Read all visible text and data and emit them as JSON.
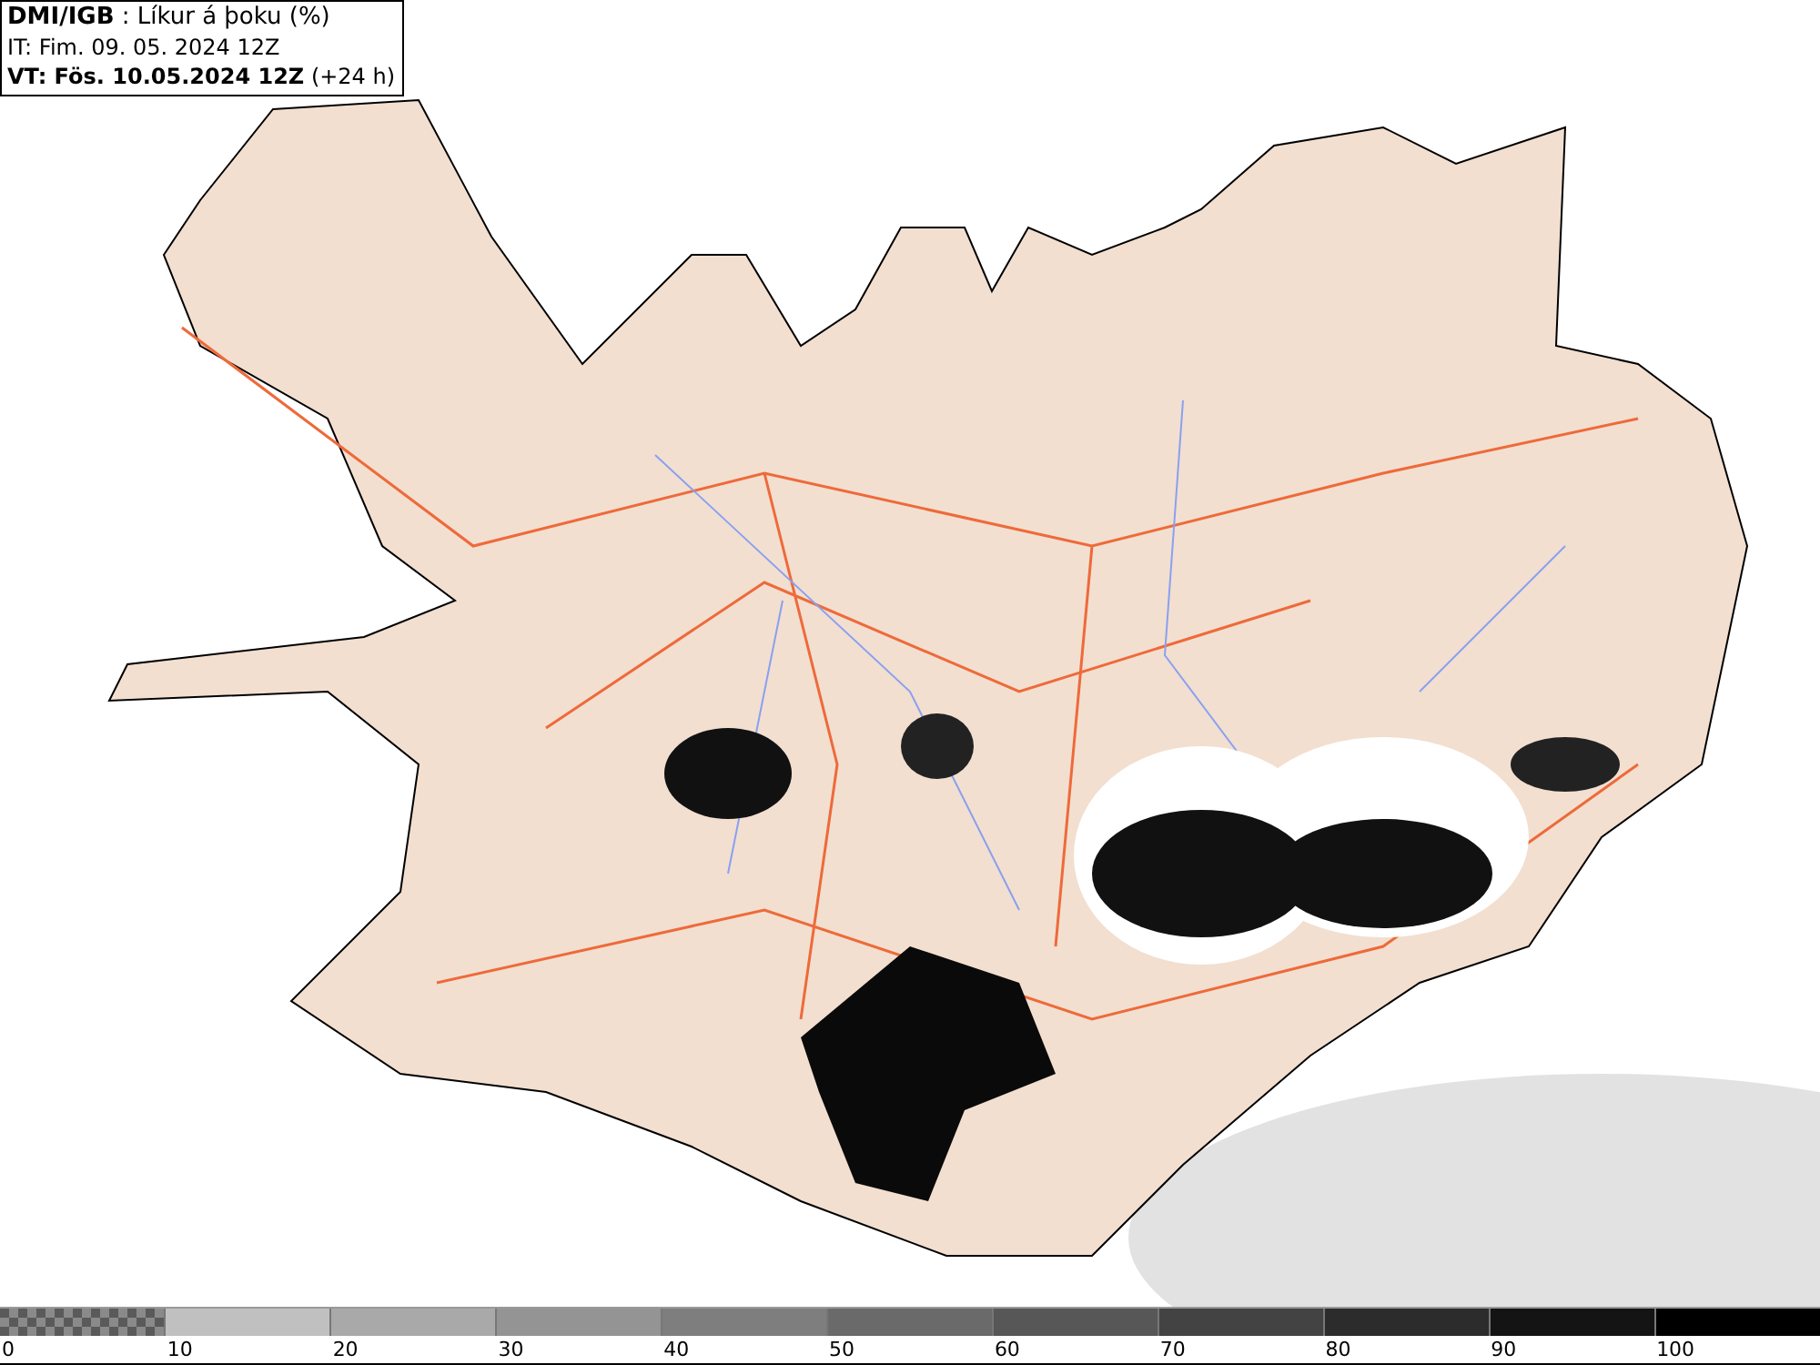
{
  "legend": {
    "title": "**DMI/IGB** : Líkur á þoku (%)",
    "issued": "IT: Fim. 09. 05. 2024 12Z",
    "valid": "**VT: Fös. 10.05.2024 12Z** (+24 h)"
  },
  "colorbar": {
    "segments": [
      {
        "kind": "checker",
        "color": "#5a5a5a"
      },
      {
        "kind": "solid",
        "color": "#c0c0c0"
      },
      {
        "kind": "solid",
        "color": "#a9a9a9"
      },
      {
        "kind": "solid",
        "color": "#949494"
      },
      {
        "kind": "solid",
        "color": "#7e7e7e"
      },
      {
        "kind": "solid",
        "color": "#6a6a6a"
      },
      {
        "kind": "solid",
        "color": "#575757"
      },
      {
        "kind": "solid",
        "color": "#434343"
      },
      {
        "kind": "solid",
        "color": "#2c2c2c"
      },
      {
        "kind": "solid",
        "color": "#141414"
      },
      {
        "kind": "solid",
        "color": "#000000"
      }
    ],
    "ticks": [
      "0",
      "10",
      "20",
      "30",
      "40",
      "50",
      "60",
      "70",
      "80",
      "90",
      "100"
    ]
  }
}
